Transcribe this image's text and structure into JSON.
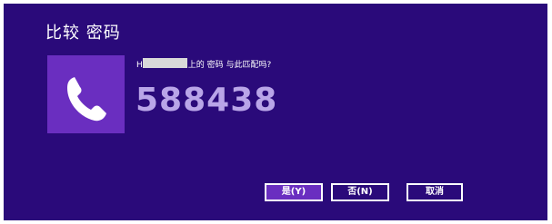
{
  "dialog": {
    "title": "比较 密码",
    "message_prefix": "H",
    "message_suffix": "上的 密码 与此匹配吗?",
    "passkey": "588438",
    "icon": "phone-icon",
    "buttons": {
      "yes": "是(Y)",
      "no": "否(N)",
      "cancel": "取消"
    },
    "colors": {
      "background": "#2a0a7a",
      "tile": "#6a2ec0",
      "passkey": "#b9a5e8",
      "primary_button": "#6a2ec0"
    }
  }
}
